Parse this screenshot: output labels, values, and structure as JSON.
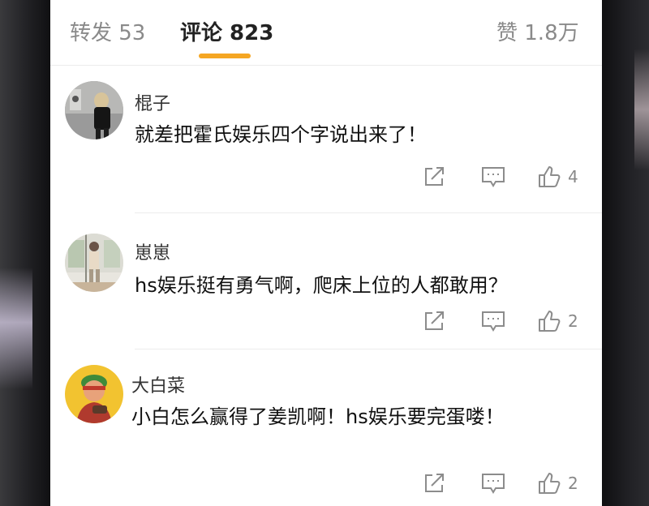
{
  "tabs": {
    "reposts": "转发 53",
    "comments": "评论 823",
    "likes": "赞 1.8万"
  },
  "comments": [
    {
      "username": "棍子",
      "text": "就差把霍氏娱乐四个字说出来了！",
      "likes": "4"
    },
    {
      "username": "崽崽",
      "text": "hs娱乐挺有勇气啊，爬床上位的人都敢用？",
      "likes": "2"
    },
    {
      "username": "大白菜",
      "text": "小白怎么赢得了姜凯啊！hs娱乐要完蛋喽！",
      "likes": "2"
    }
  ],
  "colors": {
    "accent_underline": "#f5a623",
    "icon_gray": "#8c8c8c"
  }
}
